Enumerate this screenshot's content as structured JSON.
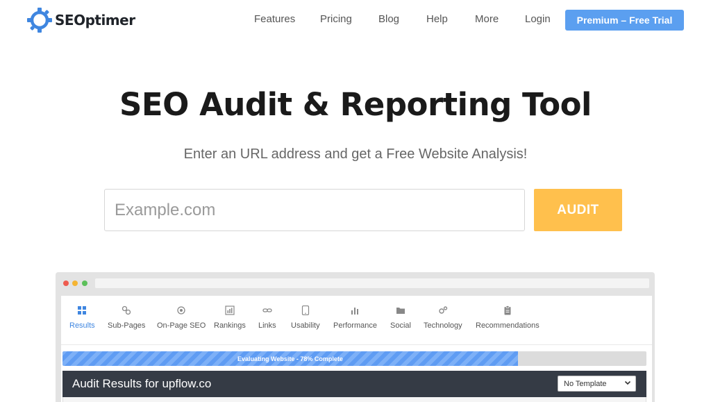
{
  "header": {
    "brand": "SEOptimer",
    "nav": [
      "Features",
      "Pricing",
      "Blog",
      "Help",
      "More",
      "Login"
    ],
    "cta_label": "Premium – Free Trial"
  },
  "hero": {
    "title": "SEO Audit & Reporting Tool",
    "subtitle": "Enter an URL address and get a Free Website Analysis!",
    "input_placeholder": "Example.com",
    "input_value": "",
    "audit_label": "AUDIT"
  },
  "preview": {
    "tabs": [
      {
        "label": "Results",
        "icon": "grid-icon",
        "active": true
      },
      {
        "label": "Sub-Pages",
        "icon": "link-chain-icon",
        "active": false
      },
      {
        "label": "On-Page SEO",
        "icon": "target-icon",
        "active": false
      },
      {
        "label": "Rankings",
        "icon": "bar-chart-icon",
        "active": false
      },
      {
        "label": "Links",
        "icon": "link-icon",
        "active": false
      },
      {
        "label": "Usability",
        "icon": "tablet-icon",
        "active": false
      },
      {
        "label": "Performance",
        "icon": "bars-icon",
        "active": false
      },
      {
        "label": "Social",
        "icon": "folder-icon",
        "active": false
      },
      {
        "label": "Technology",
        "icon": "gears-icon",
        "active": false
      },
      {
        "label": "Recommendations",
        "icon": "clipboard-icon",
        "active": false
      }
    ],
    "progress_text": "Evaluating Website - 78% Complete",
    "progress_value": 0.78,
    "results_title": "Audit Results for upflow.co",
    "template_select": "No Template"
  },
  "colors": {
    "brand_blue": "#3f86e0",
    "cta_blue": "#5b9ff0",
    "audit_yellow": "#ffc04d",
    "results_bar": "#353b45",
    "dot_red": "#ee5b4f",
    "dot_yellow": "#f5b533",
    "dot_green": "#5cc05a"
  }
}
